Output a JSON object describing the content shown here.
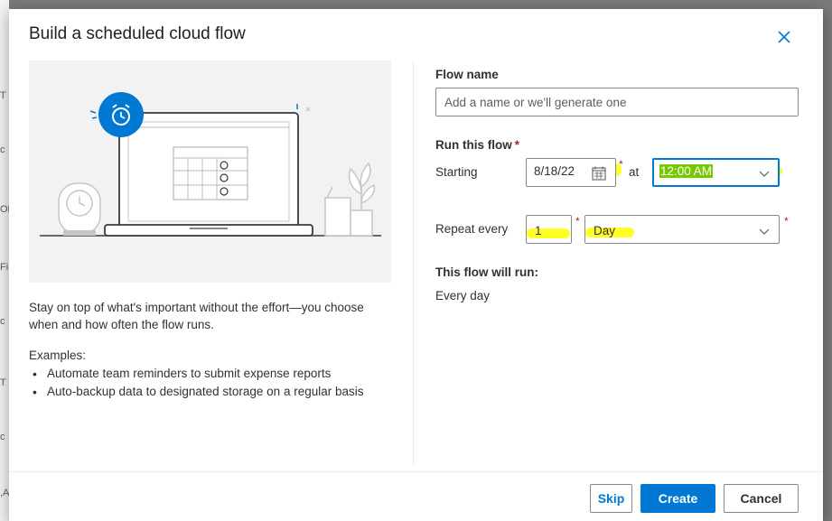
{
  "background": {
    "edge_glyphs": [
      "T",
      "c",
      "OF",
      "Fi",
      "c",
      "T",
      "c",
      ",A"
    ]
  },
  "dialog": {
    "title": "Build a scheduled cloud flow",
    "close_icon": "close-icon"
  },
  "left": {
    "description": "Stay on top of what's important without the effort—you choose when and how often the flow runs.",
    "examples_title": "Examples:",
    "examples": [
      "Automate team reminders to submit expense reports",
      "Auto-backup data to designated storage on a regular basis"
    ]
  },
  "form": {
    "flow_name_label": "Flow name",
    "flow_name_value": "",
    "flow_name_placeholder": "Add a name or we'll generate one",
    "run_this_flow_label": "Run this flow",
    "required_mark": "*",
    "starting_label": "Starting",
    "start_date": "8/18/22",
    "at_label": "at",
    "start_time": "12:00 AM",
    "repeat_every_label": "Repeat every",
    "repeat_interval": "1",
    "repeat_unit": "Day",
    "summary_label": "This flow will run:",
    "summary_value": "Every day"
  },
  "footer": {
    "skip_label": "Skip",
    "create_label": "Create",
    "cancel_label": "Cancel"
  },
  "colors": {
    "accent": "#0078d4",
    "highlight": "#ffff00",
    "required": "#a4262c"
  }
}
